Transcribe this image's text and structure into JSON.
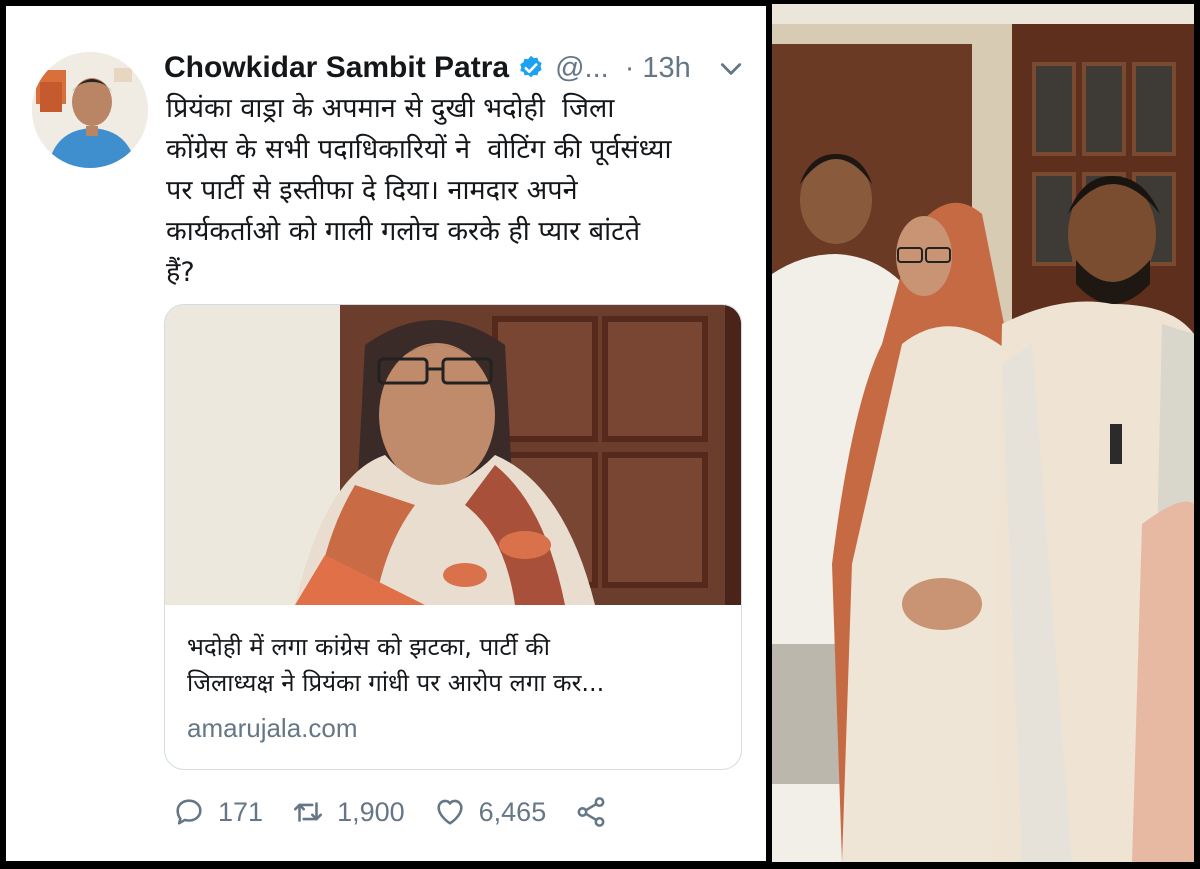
{
  "tweet": {
    "author_name": "Chowkidar Sambit Patra",
    "handle": "@...",
    "separator": "·",
    "time": "13h",
    "text": "प्रियंका वाड्रा के अपमान से दुखी भदोही  जिला\nकोंग्रेस के सभी पदाधिकारियों ने  वोटिंग की पूर्वसंध्या\nपर पार्टी से इस्तीफा दे दिया। नामदार अपने\nकार्यकर्ताओ को गाली गलोच करके ही प्यार बांटते\nहैं?",
    "card": {
      "title": "भदोही में लगा कांग्रेस को झटका, पार्टी की\nजिलाध्यक्ष ने प्रियंका गांधी पर आरोप लगा कर...",
      "domain": "amarujala.com"
    },
    "actions": {
      "replies": "171",
      "retweets": "1,900",
      "likes": "6,465"
    }
  },
  "icons": {
    "verified": "verified-badge-icon",
    "chevron": "chevron-down-icon",
    "reply": "reply-icon",
    "retweet": "retweet-icon",
    "like": "heart-icon",
    "share": "share-icon"
  },
  "colors": {
    "twitter_blue": "#1da1f2",
    "text_primary": "#14171a",
    "text_secondary": "#657786",
    "border": "#d3dce3"
  }
}
